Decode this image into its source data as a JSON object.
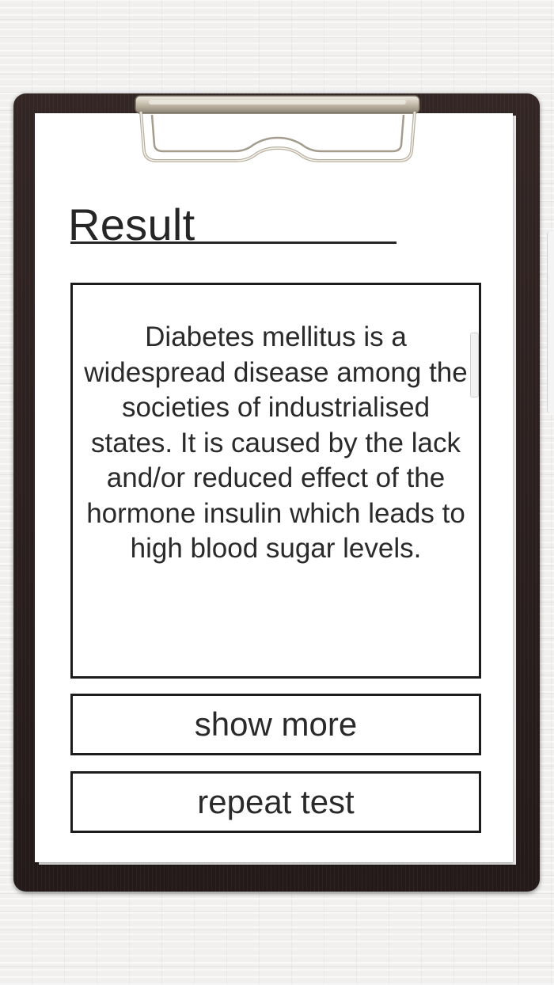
{
  "header": {
    "title": "Result"
  },
  "result": {
    "text": "Diabetes mellitus is a widespread disease among the societies of industrialised states. It is caused by the lack and/or reduced effect of the hormone insulin which leads to high blood sugar levels."
  },
  "buttons": {
    "show_more": "show more",
    "repeat_test": "repeat test"
  },
  "colors": {
    "board": "#2a1f1f",
    "paper": "#ffffff",
    "ink": "#262626",
    "background": "#ecebea",
    "clip_metal": "#c9c2b4"
  },
  "icons": {
    "clip": "clipboard-clip-icon"
  }
}
